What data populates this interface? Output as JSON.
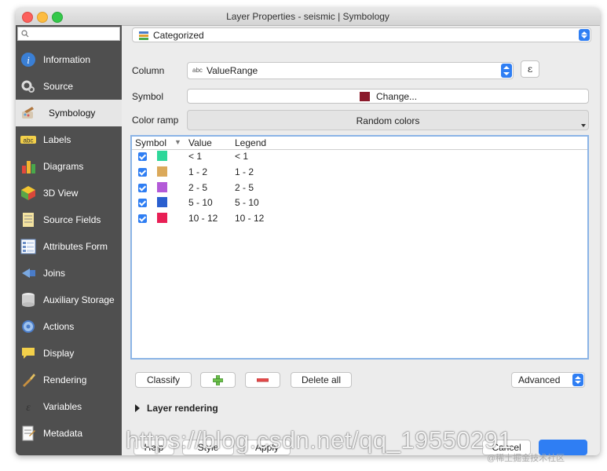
{
  "window": {
    "title": "Layer Properties - seismic | Symbology"
  },
  "sidebar": {
    "items": [
      {
        "label": "Information",
        "icon": "information-icon"
      },
      {
        "label": "Source",
        "icon": "source-icon"
      },
      {
        "label": "Symbology",
        "icon": "symbology-icon",
        "active": true
      },
      {
        "label": "Labels",
        "icon": "labels-icon"
      },
      {
        "label": "Diagrams",
        "icon": "diagrams-icon"
      },
      {
        "label": "3D View",
        "icon": "3d-view-icon"
      },
      {
        "label": "Source Fields",
        "icon": "source-fields-icon"
      },
      {
        "label": "Attributes Form",
        "icon": "attributes-form-icon"
      },
      {
        "label": "Joins",
        "icon": "joins-icon"
      },
      {
        "label": "Auxiliary Storage",
        "icon": "auxiliary-storage-icon"
      },
      {
        "label": "Actions",
        "icon": "actions-icon"
      },
      {
        "label": "Display",
        "icon": "display-icon"
      },
      {
        "label": "Rendering",
        "icon": "rendering-icon"
      },
      {
        "label": "Variables",
        "icon": "variables-icon"
      },
      {
        "label": "Metadata",
        "icon": "metadata-icon"
      }
    ]
  },
  "renderer": {
    "type": "Categorized"
  },
  "column": {
    "label": "Column",
    "type_tag": "abc",
    "value": "ValueRange",
    "expression_button": "ε"
  },
  "symbol": {
    "label": "Symbol",
    "button": "Change...",
    "color": "#8b1a2b"
  },
  "color_ramp": {
    "label": "Color ramp",
    "value": "Random colors"
  },
  "table": {
    "headers": {
      "symbol": "Symbol",
      "value": "Value",
      "legend": "Legend"
    },
    "rows": [
      {
        "value": "< 1",
        "legend": "< 1",
        "color": "#2ed79a"
      },
      {
        "value": "1 - 2",
        "legend": "1 - 2",
        "color": "#dba95a"
      },
      {
        "value": "2 - 5",
        "legend": "2 - 5",
        "color": "#b35ad8"
      },
      {
        "value": "5 - 10",
        "legend": "5 - 10",
        "color": "#2a5fcf"
      },
      {
        "value": "10 - 12",
        "legend": "10 - 12",
        "color": "#e81f55"
      }
    ]
  },
  "actions": {
    "classify": "Classify",
    "delete_all": "Delete all",
    "advanced": "Advanced"
  },
  "layer_rendering": {
    "label": "Layer rendering"
  },
  "footer": {
    "help": "Help",
    "style": "Style",
    "apply": "Apply",
    "cancel": "Cancel"
  },
  "watermark": {
    "url": "https://blog.csdn.net/qq_19550291",
    "credit": "@稀土掘金技术社区"
  }
}
